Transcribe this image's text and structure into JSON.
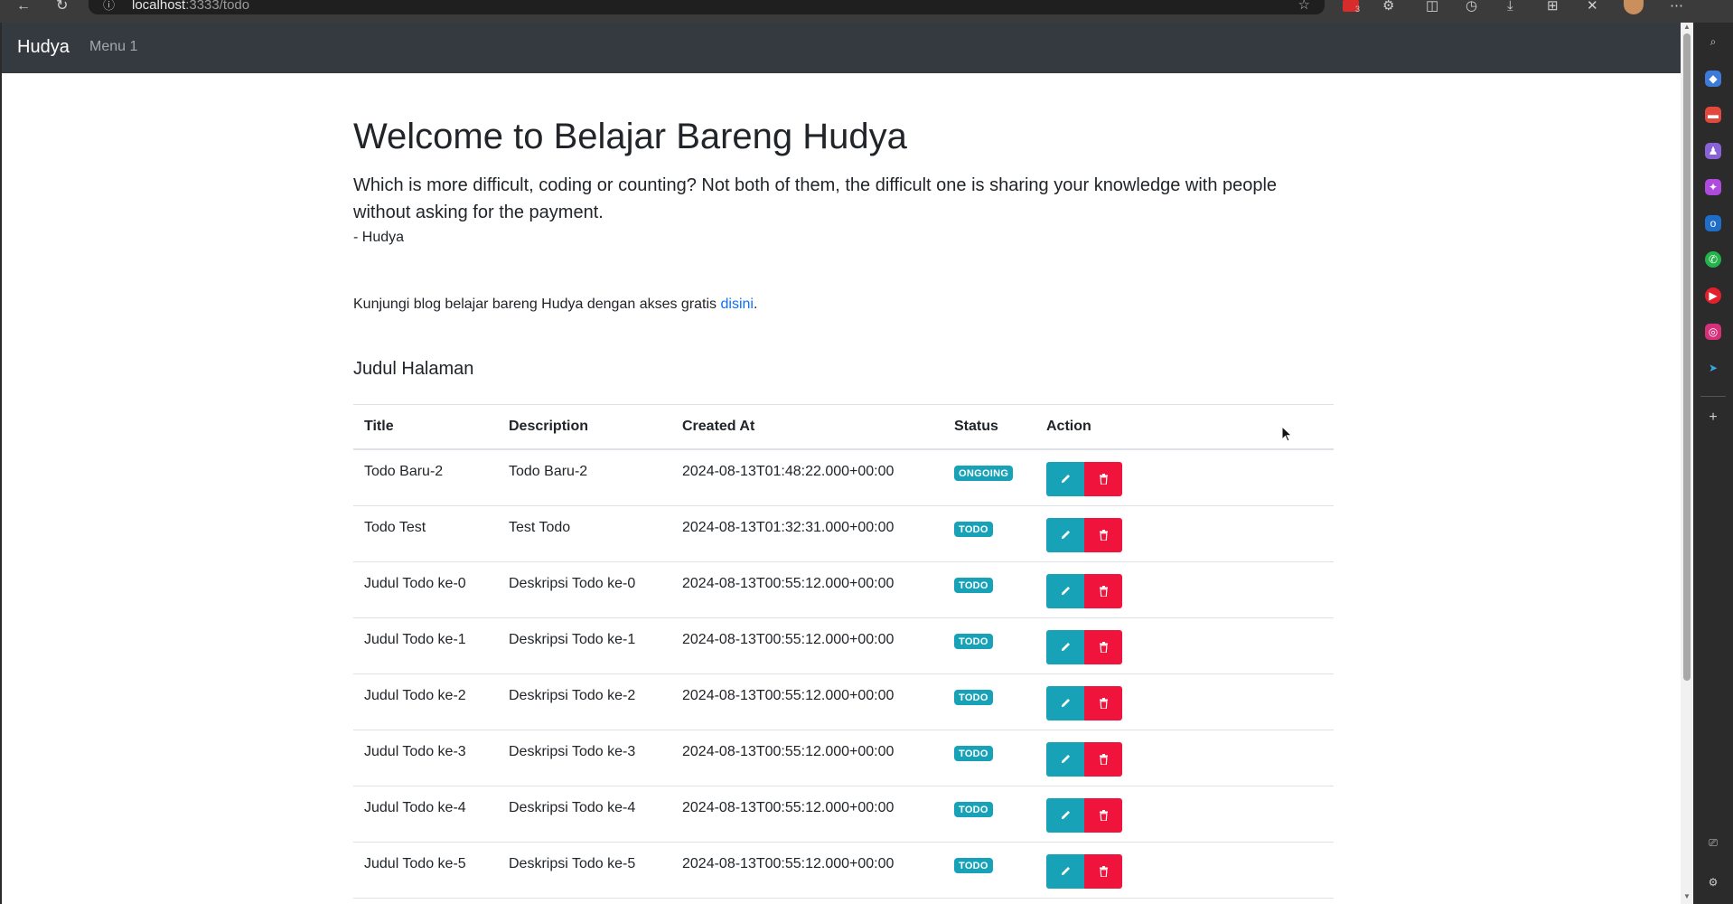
{
  "browser": {
    "url_host": "localhost",
    "url_path": ":3333/todo",
    "ext_badge_count": "3"
  },
  "navbar": {
    "brand": "Hudya",
    "menu_item": "Menu 1"
  },
  "hero": {
    "title": "Welcome to Belajar Bareng Hudya",
    "lead": "Which is more difficult, coding or counting? Not both of them, the difficult one is sharing your knowledge with people without asking for the payment.",
    "author": "- Hudya"
  },
  "blog": {
    "text": "Kunjungi blog belajar bareng Hudya dengan akses gratis ",
    "link_label": "disini",
    "suffix": "."
  },
  "section_title": "Judul Halaman",
  "table": {
    "headers": [
      "Title",
      "Description",
      "Created At",
      "Status",
      "Action"
    ],
    "rows": [
      {
        "title": "Todo Baru-2",
        "description": "Todo Baru-2",
        "created_at": "2024-08-13T01:48:22.000+00:00",
        "status": "ONGOING"
      },
      {
        "title": "Todo Test",
        "description": "Test Todo",
        "created_at": "2024-08-13T01:32:31.000+00:00",
        "status": "TODO"
      },
      {
        "title": "Judul Todo ke-0",
        "description": "Deskripsi Todo ke-0",
        "created_at": "2024-08-13T00:55:12.000+00:00",
        "status": "TODO"
      },
      {
        "title": "Judul Todo ke-1",
        "description": "Deskripsi Todo ke-1",
        "created_at": "2024-08-13T00:55:12.000+00:00",
        "status": "TODO"
      },
      {
        "title": "Judul Todo ke-2",
        "description": "Deskripsi Todo ke-2",
        "created_at": "2024-08-13T00:55:12.000+00:00",
        "status": "TODO"
      },
      {
        "title": "Judul Todo ke-3",
        "description": "Deskripsi Todo ke-3",
        "created_at": "2024-08-13T00:55:12.000+00:00",
        "status": "TODO"
      },
      {
        "title": "Judul Todo ke-4",
        "description": "Deskripsi Todo ke-4",
        "created_at": "2024-08-13T00:55:12.000+00:00",
        "status": "TODO"
      },
      {
        "title": "Judul Todo ke-5",
        "description": "Deskripsi Todo ke-5",
        "created_at": "2024-08-13T00:55:12.000+00:00",
        "status": "TODO"
      }
    ]
  },
  "icons": {
    "edit": "pencil-icon",
    "delete": "trash-icon"
  },
  "colors": {
    "navbar_bg": "#343a40",
    "badge": "#17a2b8",
    "edit_button": "#17a2b8",
    "delete_button": "#f0143c",
    "link": "#0d6efd"
  }
}
